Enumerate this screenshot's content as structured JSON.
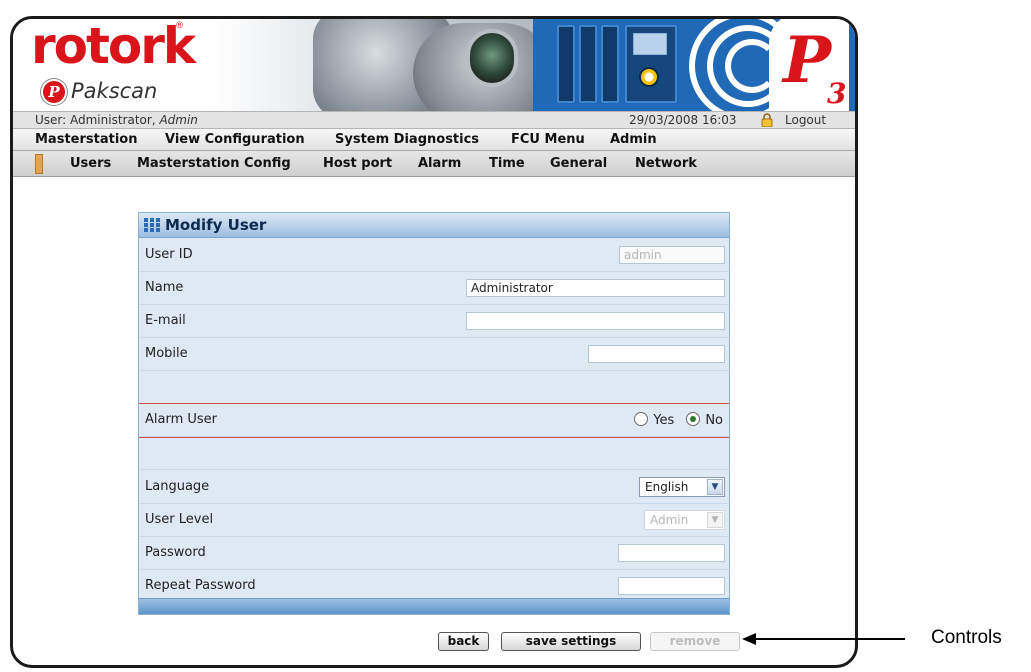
{
  "brand": {
    "logo_text": "rotork",
    "registered": "®",
    "product": "Pakscan",
    "product_badge": "P",
    "p3_letter": "P",
    "p3_sub": "3"
  },
  "status": {
    "user_prefix": "User: Administrator,",
    "user_role": "Admin",
    "datetime": "29/03/2008 16:03",
    "logout": "Logout"
  },
  "main_nav": [
    "Masterstation",
    "View Configuration",
    "System Diagnostics",
    "FCU Menu",
    "Admin"
  ],
  "sub_nav": [
    "Users",
    "Masterstation Config",
    "Host port",
    "Alarm",
    "Time",
    "General",
    "Network"
  ],
  "panel": {
    "title": "Modify User",
    "user_id": {
      "label": "User ID",
      "value": "admin"
    },
    "name": {
      "label": "Name",
      "value": "Administrator"
    },
    "email": {
      "label": "E-mail",
      "value": ""
    },
    "mobile": {
      "label": "Mobile",
      "value": ""
    },
    "alarm_user": {
      "label": "Alarm User",
      "yes": "Yes",
      "no": "No",
      "selected": "No"
    },
    "language": {
      "label": "Language",
      "value": "English"
    },
    "user_level": {
      "label": "User Level",
      "value": "Admin"
    },
    "password": {
      "label": "Password",
      "value": ""
    },
    "repeat_password": {
      "label": "Repeat Password",
      "value": ""
    }
  },
  "controls": {
    "back": "back",
    "save": "save settings",
    "remove": "remove"
  },
  "annotation": "Controls"
}
